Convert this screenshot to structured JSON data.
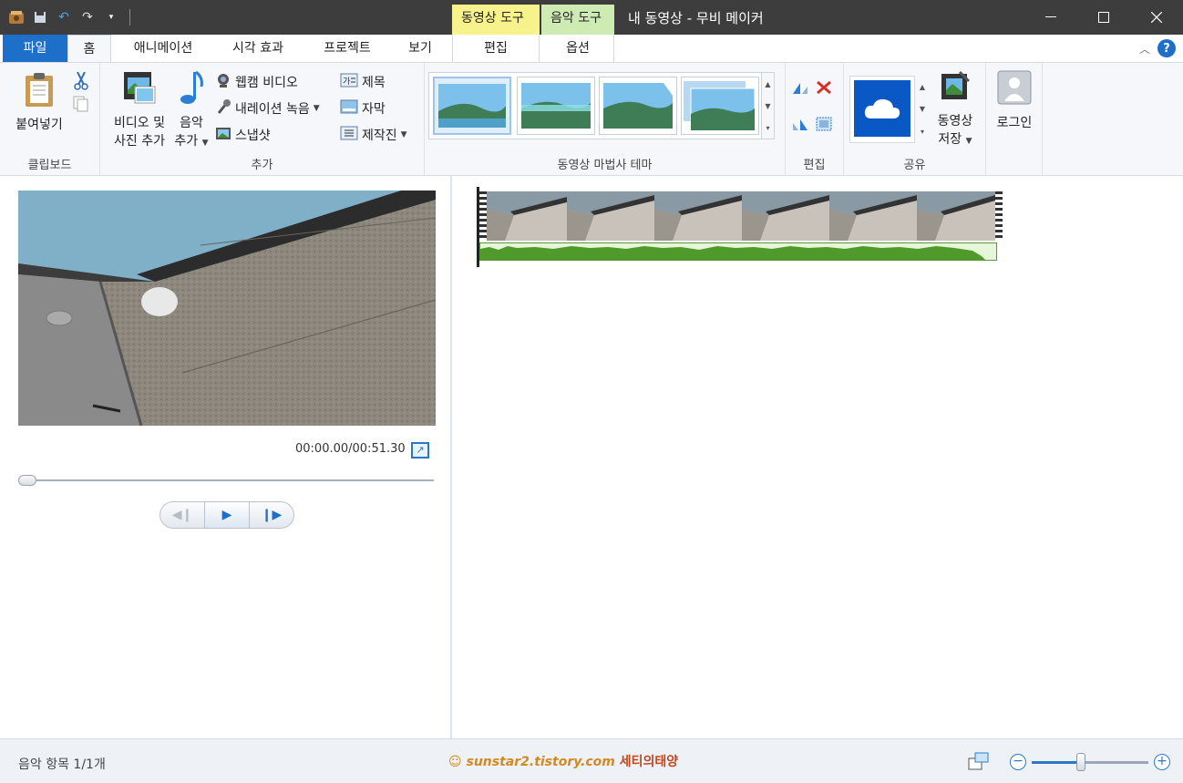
{
  "window": {
    "title": "내 동영상 - 무비 메이커",
    "context_tab_video": "동영상 도구",
    "context_tab_audio": "음악 도구"
  },
  "tabs": {
    "file": "파일",
    "home": "홈",
    "animations": "애니메이션",
    "visual_effects": "시각 효과",
    "project": "프로젝트",
    "view": "보기",
    "edit": "편집",
    "options": "옵션"
  },
  "ribbon": {
    "clipboard": {
      "paste": "붙여넣기",
      "label": "클립보드"
    },
    "add": {
      "add_video_photo_line1": "비디오 및",
      "add_video_photo_line2": "사진 추가",
      "add_music_line1": "음악",
      "add_music_line2": "추가",
      "webcam_video": "웹캠 비디오",
      "record_narration": "내레이션 녹음",
      "snapshot": "스냅샷",
      "title": "제목",
      "caption": "자막",
      "credits": "제작진",
      "label": "추가"
    },
    "themes": {
      "label": "동영상 마법사 테마"
    },
    "editing": {
      "label": "편집"
    },
    "share": {
      "save_movie_line1": "동영상",
      "save_movie_line2": "저장",
      "label": "공유"
    },
    "signin": {
      "label": "로그인"
    }
  },
  "preview": {
    "timecode": "00:00.00/00:51.30",
    "seek_position": 0.0
  },
  "status": {
    "text": "음악 항목 1/1개",
    "watermark_site": "sunstar2.tistory.com",
    "watermark_name": "세티의태양",
    "zoom_level": 0.42
  },
  "colors": {
    "file_tab": "#1e6fc9",
    "video_tools": "#f7f28c",
    "audio_tools": "#cdebb2",
    "titlebar": "#3d3d3d",
    "audio_wave": "#4f9a2a"
  }
}
